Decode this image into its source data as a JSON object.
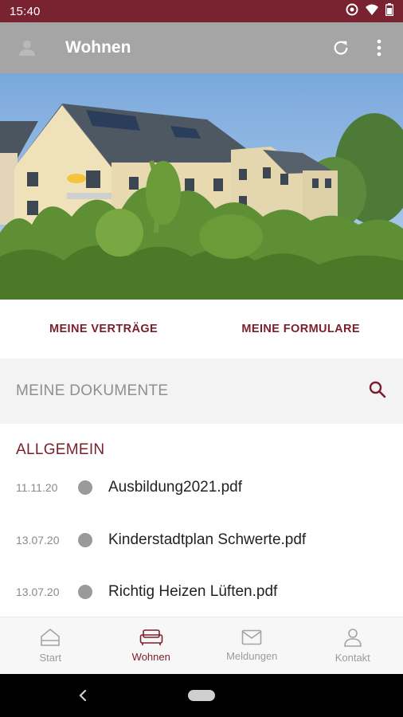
{
  "status_bar": {
    "time": "15:40"
  },
  "app_bar": {
    "title": "Wohnen"
  },
  "actions": {
    "primary_left": "MEINE VERTRÄGE",
    "primary_right": "MEINE FORMULARE"
  },
  "search": {
    "label": "MEINE DOKUMENTE"
  },
  "section": {
    "title": "ALLGEMEIN",
    "documents": [
      {
        "date": "11.11.20",
        "name": "Ausbildung2021.pdf"
      },
      {
        "date": "13.07.20",
        "name": "Kinderstadtplan Schwerte.pdf"
      },
      {
        "date": "13.07.20",
        "name": "Richtig Heizen Lüften.pdf"
      }
    ]
  },
  "bottom_nav": {
    "items": [
      {
        "label": "Start",
        "icon": "home-icon"
      },
      {
        "label": "Wohnen",
        "icon": "sofa-icon"
      },
      {
        "label": "Meldungen",
        "icon": "mail-icon"
      },
      {
        "label": "Kontakt",
        "icon": "person-icon"
      }
    ],
    "active_index": 1
  },
  "colors": {
    "brand": "#7a1f2b",
    "status_bar": "#7a2330",
    "app_bar": "#a5a5a5"
  }
}
